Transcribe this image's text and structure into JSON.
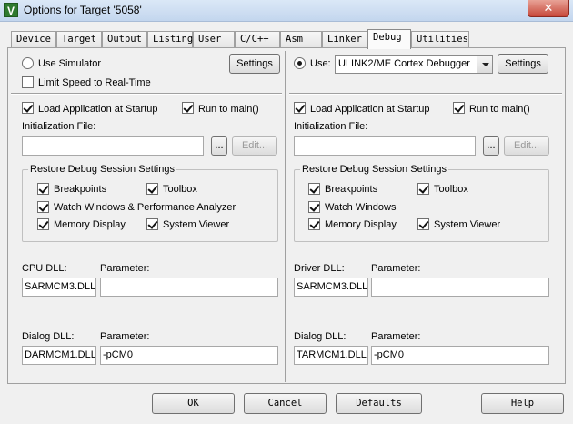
{
  "window": {
    "title": "Options for Target '5058'",
    "close": "✕",
    "app_icon": "keil-uv-icon"
  },
  "tabs": [
    {
      "label": "Device"
    },
    {
      "label": "Target"
    },
    {
      "label": "Output"
    },
    {
      "label": "Listing"
    },
    {
      "label": "User"
    },
    {
      "label": "C/C++"
    },
    {
      "label": "Asm"
    },
    {
      "label": "Linker"
    },
    {
      "label": "Debug",
      "active": true
    },
    {
      "label": "Utilities"
    }
  ],
  "left": {
    "use_simulator": "Use Simulator",
    "settings": "Settings",
    "limit_speed": "Limit Speed to Real-Time",
    "load_app": "Load Application at Startup",
    "run_to_main": "Run to main()",
    "init_file": "Initialization File:",
    "browse": "...",
    "edit": "Edit...",
    "restore_title": "Restore Debug Session Settings",
    "breakpoints": "Breakpoints",
    "toolbox": "Toolbox",
    "watch_windows": "Watch Windows & Performance Analyzer",
    "memory_display": "Memory Display",
    "system_viewer": "System Viewer",
    "cpu_dll_label": "CPU DLL:",
    "cpu_param_label": "Parameter:",
    "cpu_dll": "SARMCM3.DLL",
    "cpu_param": "",
    "dialog_dll_label": "Dialog DLL:",
    "dialog_param_label": "Parameter:",
    "dialog_dll": "DARMCM1.DLL",
    "dialog_param": "-pCM0"
  },
  "right": {
    "use": "Use:",
    "debugger": "ULINK2/ME Cortex Debugger",
    "settings": "Settings",
    "load_app": "Load Application at Startup",
    "run_to_main": "Run to main()",
    "init_file": "Initialization File:",
    "browse": "...",
    "edit": "Edit...",
    "restore_title": "Restore Debug Session Settings",
    "breakpoints": "Breakpoints",
    "toolbox": "Toolbox",
    "watch_windows": "Watch Windows",
    "memory_display": "Memory Display",
    "system_viewer": "System Viewer",
    "driver_dll_label": "Driver DLL:",
    "driver_param_label": "Parameter:",
    "driver_dll": "SARMCM3.DLL",
    "driver_param": "",
    "dialog_dll_label": "Dialog DLL:",
    "dialog_param_label": "Parameter:",
    "dialog_dll": "TARMCM1.DLL",
    "dialog_param": "-pCM0"
  },
  "footer": {
    "ok": "OK",
    "cancel": "Cancel",
    "defaults": "Defaults",
    "help": "Help"
  }
}
